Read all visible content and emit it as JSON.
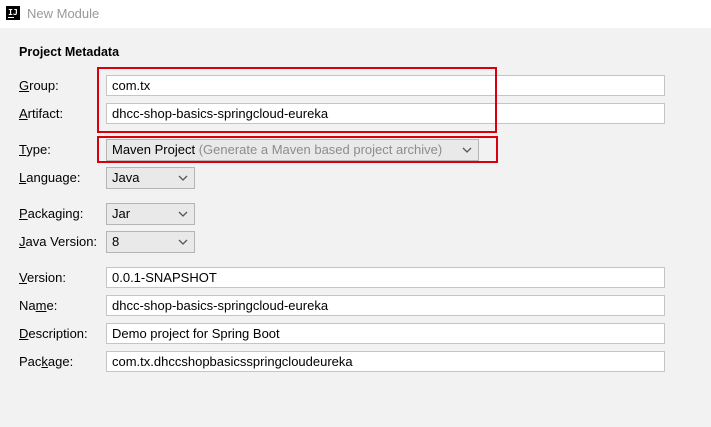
{
  "window": {
    "title": "New Module",
    "icon": "intellij-idea-icon"
  },
  "section": {
    "title": "Project Metadata"
  },
  "fields": {
    "group": {
      "label": "Group:",
      "value": "com.tx"
    },
    "artifact": {
      "label": "Artifact:",
      "value": "dhcc-shop-basics-springcloud-eureka"
    },
    "type": {
      "label": "Type:",
      "value": "Maven Project",
      "hint": "(Generate a Maven based project archive)"
    },
    "language": {
      "label": "Language:",
      "value": "Java"
    },
    "packaging": {
      "label": "Packaging:",
      "value": "Jar"
    },
    "java_version": {
      "label": "Java Version:",
      "value": "8"
    },
    "version": {
      "label": "Version:",
      "value": "0.0.1-SNAPSHOT"
    },
    "name": {
      "label": "Name:",
      "value": "dhcc-shop-basics-springcloud-eureka"
    },
    "description": {
      "label": "Description:",
      "value": "Demo project for Spring Boot"
    },
    "package": {
      "label": "Package:",
      "value": "com.tx.dhccshopbasicsspringcloudeureka"
    }
  },
  "highlight_color": "#d9000d"
}
